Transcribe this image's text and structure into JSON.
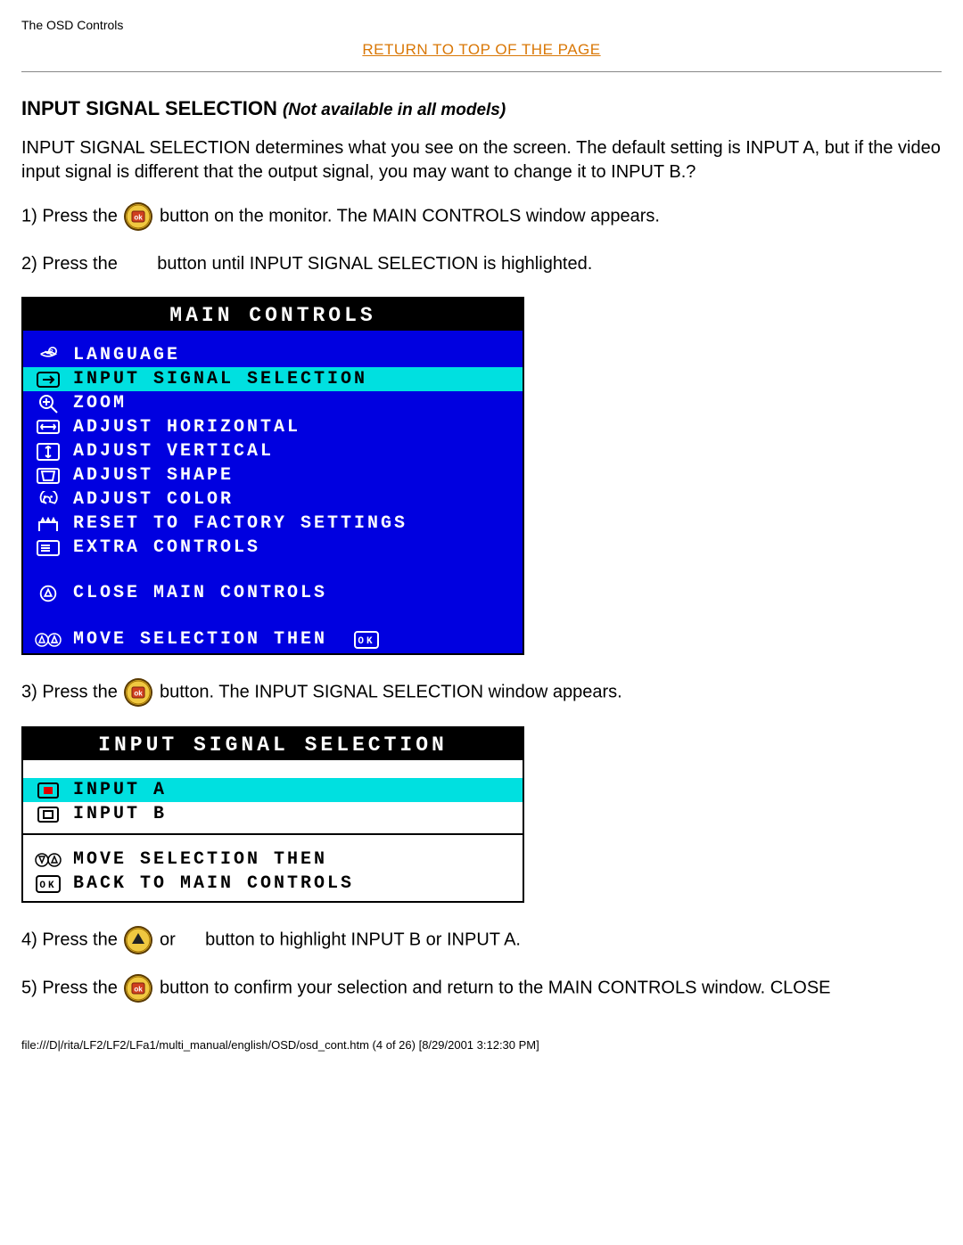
{
  "page_header": "The OSD Controls",
  "return_top": "RETURN TO TOP OF THE PAGE",
  "section_title": "INPUT SIGNAL SELECTION",
  "section_note": "(Not available in all models)",
  "intro": "INPUT SIGNAL SELECTION determines what you see on the screen. The default setting is INPUT A, but if the video input signal is different that the output signal, you may want to change it to INPUT B.?",
  "step1_a": "1) Press the ",
  "step1_b": " button on the monitor. The MAIN CONTROLS window appears.",
  "step2_a": "2) Press the ",
  "step2_b": " button until INPUT SIGNAL SELECTION is highlighted.",
  "osd1": {
    "title": "MAIN CONTROLS",
    "items": [
      "LANGUAGE",
      "INPUT SIGNAL SELECTION",
      "ZOOM",
      "ADJUST HORIZONTAL",
      "ADJUST VERTICAL",
      "ADJUST SHAPE",
      "ADJUST COLOR",
      "RESET TO FACTORY SETTINGS",
      "EXTRA CONTROLS"
    ],
    "close": "CLOSE MAIN CONTROLS",
    "footer": "MOVE SELECTION THEN"
  },
  "step3_a": "3) Press the ",
  "step3_b": " button. The INPUT SIGNAL SELECTION window appears.",
  "osd2": {
    "title": "INPUT SIGNAL SELECTION",
    "input_a": "INPUT A",
    "input_b": "INPUT B",
    "footer1": "MOVE SELECTION THEN",
    "footer2": "BACK TO MAIN CONTROLS"
  },
  "step4_a": "4) Press the ",
  "step4_b": " or ",
  "step4_c": " button to highlight INPUT B or INPUT A.",
  "step5_a": "5) Press the ",
  "step5_b": " button to confirm your selection and return to the MAIN CONTROLS window. CLOSE",
  "footer": "file:///D|/rita/LF2/LF2/LFa1/multi_manual/english/OSD/osd_cont.htm (4 of 26) [8/29/2001 3:12:30 PM]"
}
